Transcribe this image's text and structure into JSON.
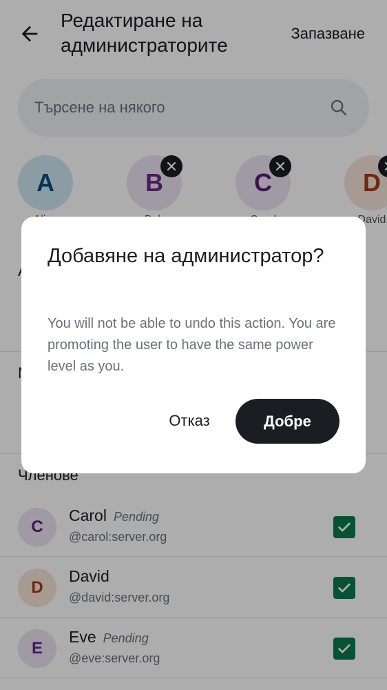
{
  "header": {
    "title": "Редактиране на администраторите",
    "save_label": "Запазване"
  },
  "search": {
    "placeholder": "Търсене на някого"
  },
  "selected": [
    {
      "initial": "A",
      "label": "Alice",
      "bg": "#cfe6f3",
      "fg": "#0a4f7a",
      "removable": false
    },
    {
      "initial": "B",
      "label": "Bob",
      "bg": "#ece3f2",
      "fg": "#6b2a85",
      "removable": true
    },
    {
      "initial": "C",
      "label": "Carol",
      "bg": "#ece3f2",
      "fg": "#5b1e73",
      "removable": true
    },
    {
      "initial": "D",
      "label": "David",
      "bg": "#f6e3d8",
      "fg": "#a33b1a",
      "removable": true
    }
  ],
  "sections": {
    "admins": "А",
    "moderators": "М",
    "members": "Членове"
  },
  "members": [
    {
      "initial": "C",
      "name": "Carol",
      "pending": "Pending",
      "user_id": "@carol:server.org",
      "bg": "#ece3f2",
      "fg": "#5b1e73",
      "checked": true
    },
    {
      "initial": "D",
      "name": "David",
      "pending": "",
      "user_id": "@david:server.org",
      "bg": "#f6e3d8",
      "fg": "#a33b1a",
      "checked": true
    },
    {
      "initial": "E",
      "name": "Eve",
      "pending": "Pending",
      "user_id": "@eve:server.org",
      "bg": "#ece3f2",
      "fg": "#5b2a85",
      "checked": true
    }
  ],
  "dialog": {
    "title": "Добавяне на администратор?",
    "body": "You will not be able to undo this action. You are promoting the user to have the same power level as you.",
    "cancel_label": "Отказ",
    "ok_label": "Добре"
  },
  "colors": {
    "check": "#0b7a4d",
    "primary_button": "#1b1d22"
  }
}
